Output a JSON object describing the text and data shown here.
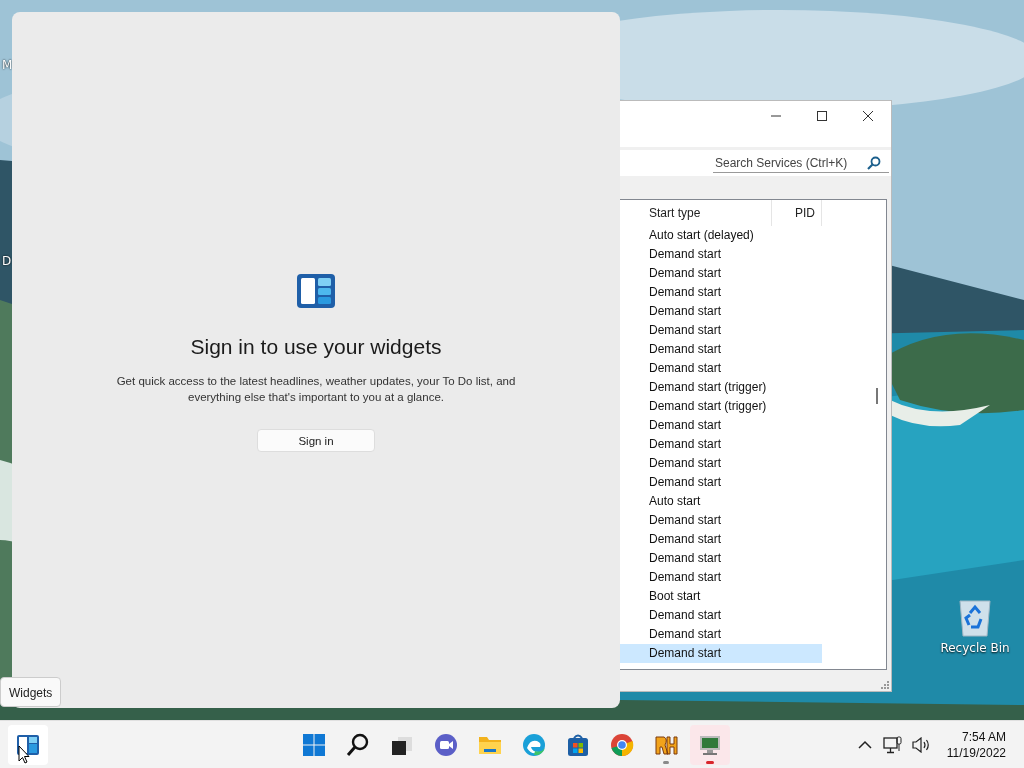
{
  "desktop": {
    "icons": [
      {
        "kind": "edge-label",
        "label": "M"
      },
      {
        "kind": "edge-label",
        "label": "D"
      },
      {
        "kind": "recycle-bin",
        "label": "Recycle Bin"
      }
    ]
  },
  "services_window": {
    "search": {
      "placeholder": "Search Services (Ctrl+K)"
    },
    "columns": [
      "Start type",
      "PID"
    ],
    "rows": [
      {
        "start_type": "Auto start (delayed)",
        "selected": false
      },
      {
        "start_type": "Demand start",
        "selected": false
      },
      {
        "start_type": "Demand start",
        "selected": false
      },
      {
        "start_type": "Demand start",
        "selected": false
      },
      {
        "start_type": "Demand start",
        "selected": false
      },
      {
        "start_type": "Demand start",
        "selected": false
      },
      {
        "start_type": "Demand start",
        "selected": false
      },
      {
        "start_type": "Demand start",
        "selected": false
      },
      {
        "start_type": "Demand start (trigger)",
        "selected": false
      },
      {
        "start_type": "Demand start (trigger)",
        "selected": false
      },
      {
        "start_type": "Demand start",
        "selected": false
      },
      {
        "start_type": "Demand start",
        "selected": false
      },
      {
        "start_type": "Demand start",
        "selected": false
      },
      {
        "start_type": "Demand start",
        "selected": false
      },
      {
        "start_type": "Auto start",
        "selected": false
      },
      {
        "start_type": "Demand start",
        "selected": false
      },
      {
        "start_type": "Demand start",
        "selected": false
      },
      {
        "start_type": "Demand start",
        "selected": false
      },
      {
        "start_type": "Demand start",
        "selected": false
      },
      {
        "start_type": "Boot start",
        "selected": false
      },
      {
        "start_type": "Demand start",
        "selected": false
      },
      {
        "start_type": "Demand start",
        "selected": false
      },
      {
        "start_type": "Demand start",
        "selected": true
      }
    ]
  },
  "widgets_panel": {
    "title": "Sign in to use your widgets",
    "description": "Get quick access to the latest headlines, weather updates, your To Do list, and everything else that's important to you at a glance.",
    "button": "Sign in"
  },
  "tooltip": "Widgets",
  "taskbar": {
    "widgets_button": {
      "selected": true
    },
    "apps": [
      {
        "kind": "start",
        "running": false,
        "active": false
      },
      {
        "kind": "search",
        "running": false,
        "active": false
      },
      {
        "kind": "taskview",
        "running": false,
        "active": false
      },
      {
        "kind": "chat",
        "running": false,
        "active": false
      },
      {
        "kind": "explorer",
        "running": false,
        "active": false
      },
      {
        "kind": "edge",
        "running": false,
        "active": false
      },
      {
        "kind": "store",
        "running": false,
        "active": false
      },
      {
        "kind": "chrome",
        "running": false,
        "active": false
      },
      {
        "kind": "rh",
        "running": true,
        "active": false
      },
      {
        "kind": "monitor",
        "running": true,
        "active": true
      }
    ],
    "tray": {
      "time": "7:54 AM",
      "date": "11/19/2022"
    }
  }
}
